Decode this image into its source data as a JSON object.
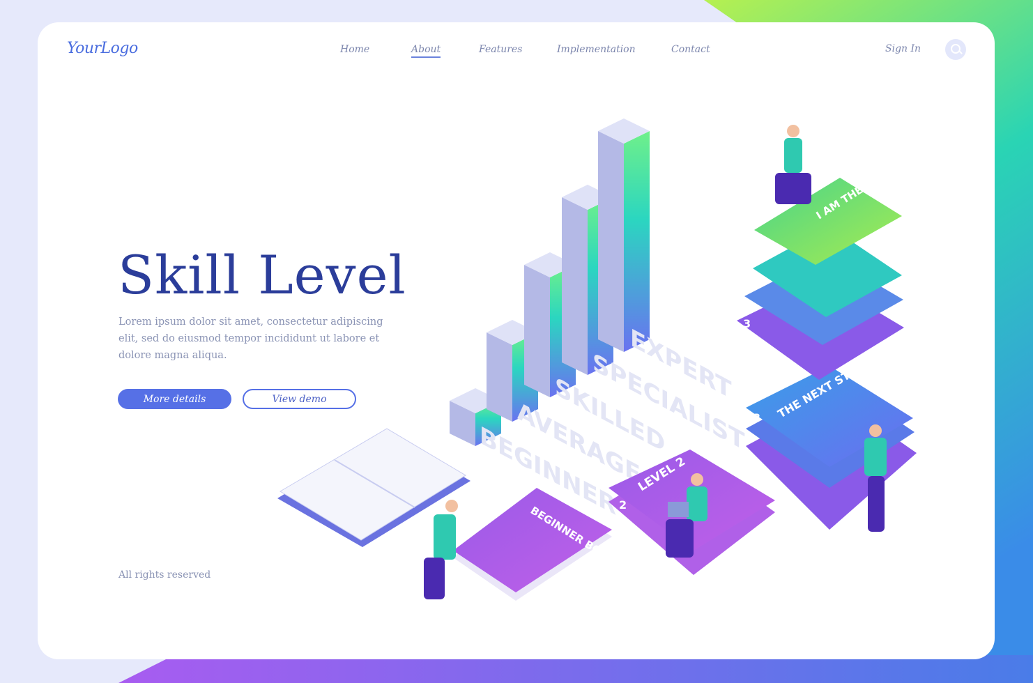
{
  "header": {
    "logo": "YourLogo",
    "nav": [
      {
        "label": "Home"
      },
      {
        "label": "About",
        "active": true
      },
      {
        "label": "Features"
      },
      {
        "label": "Implementation"
      },
      {
        "label": "Contact"
      }
    ],
    "sign_in": "Sign In",
    "search_icon": "search-icon"
  },
  "hero": {
    "title": "Skill Level",
    "description": "Lorem ipsum dolor sit amet, consectetur adipiscing elit, sed do eiusmod tempor incididunt ut labore et dolore magna aliqua.",
    "primary_button": "More details",
    "secondary_button": "View demo"
  },
  "footer": {
    "text": "All rights reserved"
  },
  "illustration": {
    "levels": [
      "BEGINNER",
      "AVERAGE",
      "SKILLED",
      "SPECIALIST",
      "EXPERT"
    ],
    "books": {
      "expert": "I AM THE EXPERT",
      "next": "THE NEXT STEP",
      "level2": "LEVEL 2",
      "beginner": "BEGINNER BOOK",
      "num3": "3",
      "num2": "2"
    }
  },
  "colors": {
    "accent": "#5670e6",
    "title": "#2b3d9a",
    "teal": "#2fd6b0",
    "purple": "#8a4fe0",
    "lime": "#a6f05a"
  }
}
